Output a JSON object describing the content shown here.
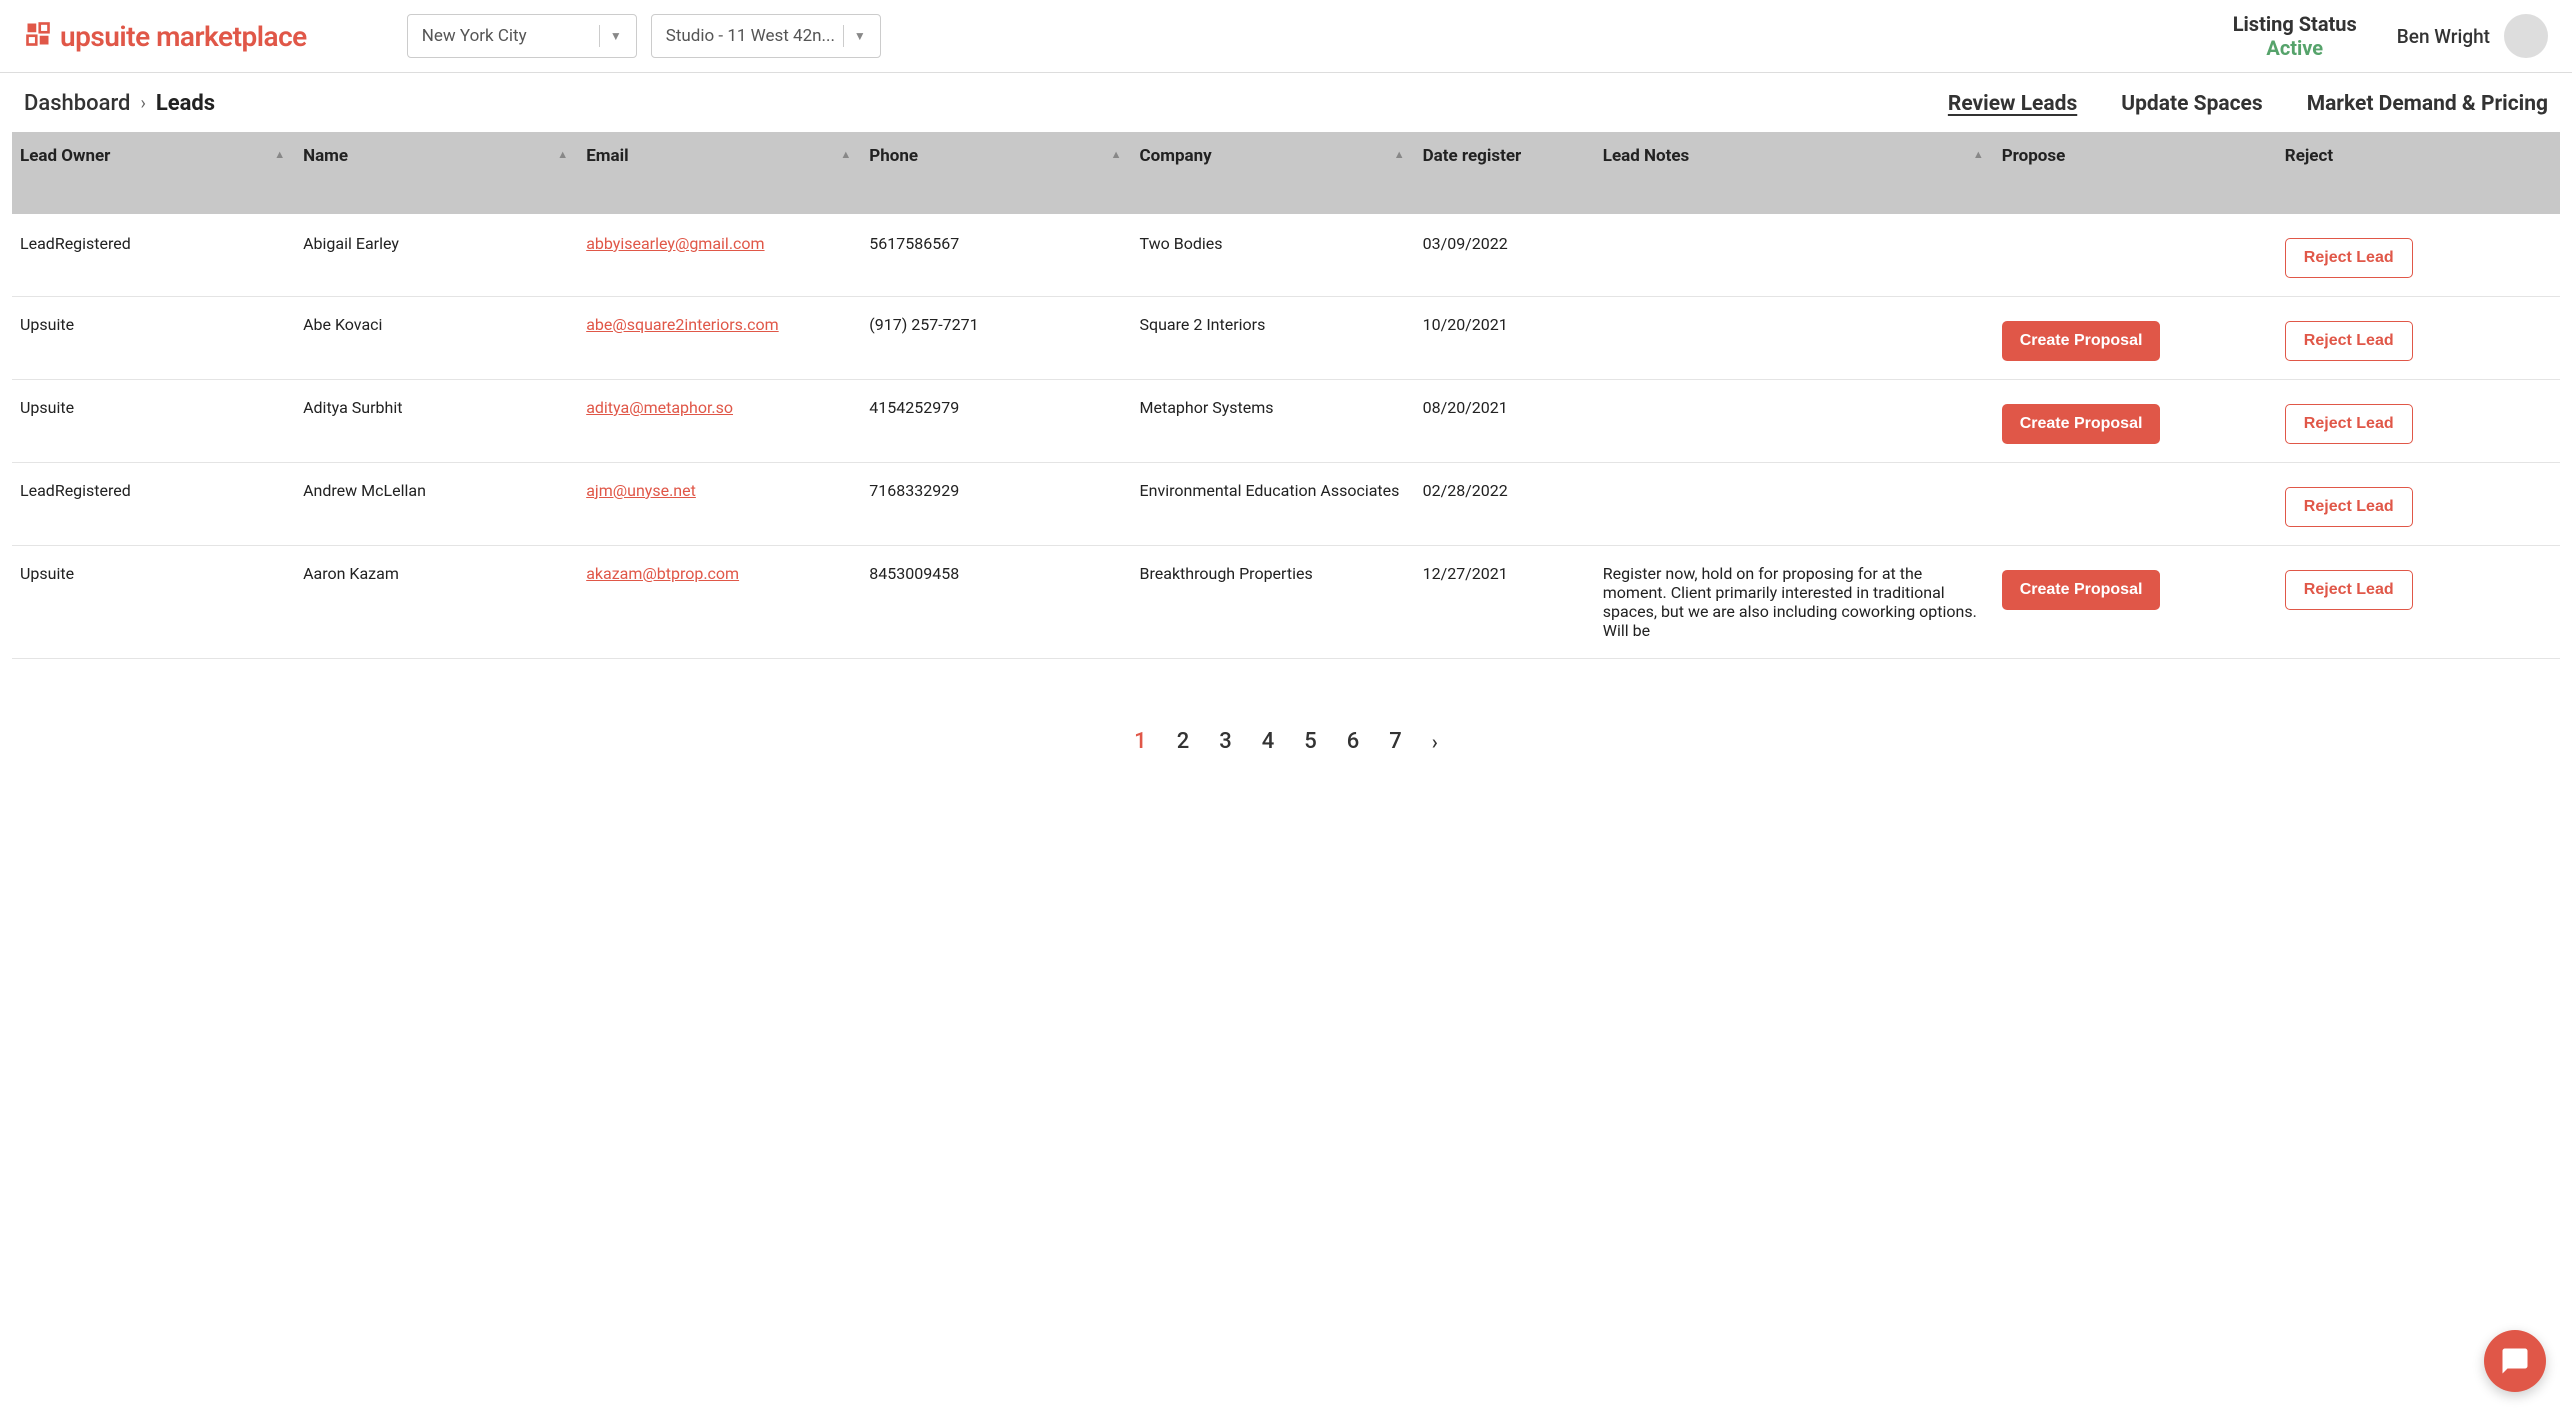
{
  "header": {
    "logo_text": "upsuite marketplace",
    "location_select": "New York City",
    "space_select": "Studio - 11 West 42n...",
    "listing_status_label": "Listing Status",
    "listing_status_value": "Active",
    "user_name": "Ben Wright"
  },
  "breadcrumb": {
    "root": "Dashboard",
    "current": "Leads"
  },
  "tabs": {
    "review_leads": "Review Leads",
    "update_spaces": "Update Spaces",
    "market_demand": "Market Demand & Pricing"
  },
  "columns": {
    "lead_owner": "Lead Owner",
    "name": "Name",
    "email": "Email",
    "phone": "Phone",
    "company": "Company",
    "date_register": "Date register",
    "lead_notes": "Lead Notes",
    "propose": "Propose",
    "reject": "Reject"
  },
  "buttons": {
    "create_proposal": "Create Proposal",
    "reject_lead": "Reject Lead"
  },
  "rows": [
    {
      "owner": "LeadRegistered",
      "name": "Abigail Earley",
      "email": "abbyisearley@gmail.com",
      "phone": "5617586567",
      "company": "Two Bodies",
      "date": "03/09/2022",
      "notes": "",
      "propose": false,
      "reject": true
    },
    {
      "owner": "Upsuite",
      "name": "Abe Kovaci",
      "email": "abe@square2interiors.com",
      "phone": "(917) 257-7271",
      "company": "Square 2 Interiors",
      "date": "10/20/2021",
      "notes": "",
      "propose": true,
      "reject": true
    },
    {
      "owner": "Upsuite",
      "name": "Aditya Surbhit",
      "email": "aditya@metaphor.so",
      "phone": "4154252979",
      "company": "Metaphor Systems",
      "date": "08/20/2021",
      "notes": "",
      "propose": true,
      "reject": true
    },
    {
      "owner": "LeadRegistered",
      "name": "Andrew McLellan",
      "email": "ajm@unyse.net",
      "phone": "7168332929",
      "company": "Environmental Education Associates",
      "date": "02/28/2022",
      "notes": "",
      "propose": false,
      "reject": true
    },
    {
      "owner": "Upsuite",
      "name": "Aaron Kazam",
      "email": "akazam@btprop.com",
      "phone": "8453009458",
      "company": "Breakthrough Properties",
      "date": "12/27/2021",
      "notes": "Register now, hold on for proposing for at the moment. Client primarily interested in traditional spaces, but we are also including coworking options. Will be",
      "propose": true,
      "reject": true
    }
  ],
  "pagination": {
    "pages": [
      "1",
      "2",
      "3",
      "4",
      "5",
      "6",
      "7"
    ],
    "current": "1"
  }
}
